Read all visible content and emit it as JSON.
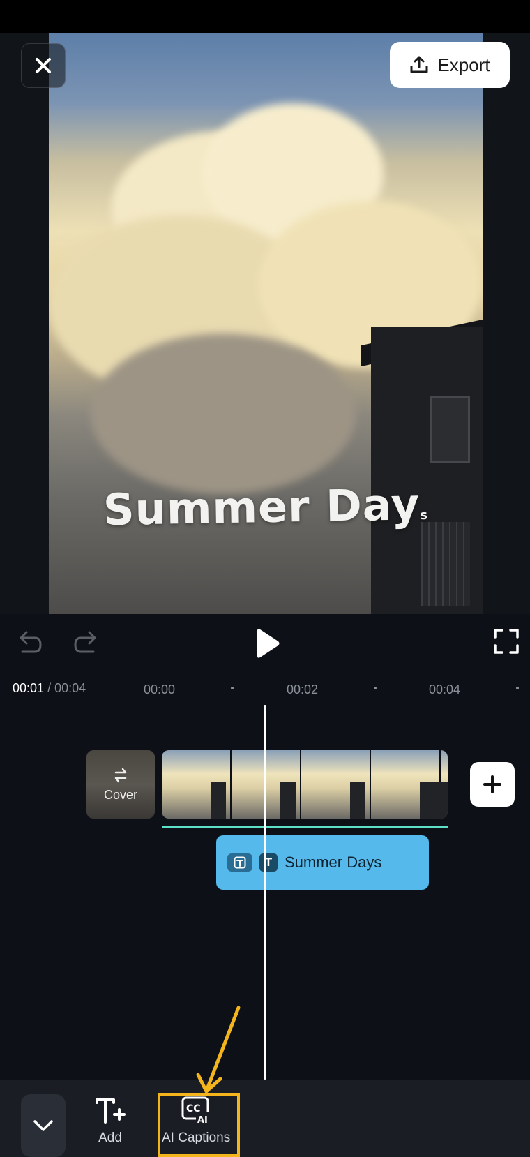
{
  "header": {
    "close_icon": "close-icon",
    "export_label": "Export",
    "export_icon": "upload-icon"
  },
  "preview": {
    "caption_text": "Summer Day",
    "caption_trailing": "s"
  },
  "controls": {
    "undo_icon": "undo-icon",
    "redo_icon": "redo-icon",
    "play_icon": "play-icon",
    "fullscreen_icon": "fullscreen-icon"
  },
  "timeline": {
    "current_time": "00:01",
    "separator": "/",
    "total_time": "00:04",
    "ticks": [
      "00:00",
      "00:02",
      "00:04"
    ],
    "cover_label": "Cover",
    "clip_count": 4,
    "text_track_label": "Summer Days",
    "accent_color": "#5ee0c8",
    "text_track_color": "#55b9ec"
  },
  "toolbar": {
    "collapse_icon": "chevron-down-icon",
    "add_label": "Add",
    "add_icon": "add-text-icon",
    "ai_captions_label": "AI Captions",
    "ai_captions_icon": "ai-captions-icon",
    "highlight_color": "#f3b51b"
  }
}
